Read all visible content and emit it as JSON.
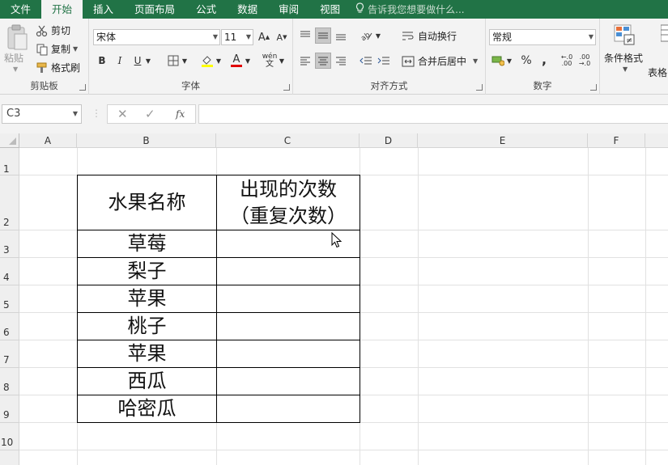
{
  "menu": {
    "tabs": [
      "文件",
      "开始",
      "插入",
      "页面布局",
      "公式",
      "数据",
      "审阅",
      "视图"
    ],
    "active_index": 1,
    "tell_me": "告诉我您想要做什么..."
  },
  "ribbon": {
    "clipboard": {
      "label": "剪贴板",
      "paste": "粘贴",
      "cut": "剪切",
      "copy": "复制",
      "format_painter": "格式刷"
    },
    "font": {
      "label": "字体",
      "font_name": "宋体",
      "font_size": "11",
      "bold": "B",
      "italic": "I",
      "underline": "U",
      "phonetic": "wén"
    },
    "alignment": {
      "label": "对齐方式",
      "wrap_text": "自动换行",
      "merge_center": "合并后居中"
    },
    "number": {
      "label": "数字",
      "format": "常规",
      "percent": "%",
      "comma": ","
    },
    "styles": {
      "conditional_format": "条件格式",
      "table_format": "表格"
    }
  },
  "formula_bar": {
    "name_box": "C3",
    "fx": "fx"
  },
  "sheet": {
    "columns": [
      "A",
      "B",
      "C",
      "D",
      "E",
      "F"
    ],
    "rows": [
      "1",
      "2",
      "3",
      "4",
      "5",
      "6",
      "7",
      "8",
      "9",
      "10"
    ],
    "header_b2": "水果名称",
    "header_c2_line1": "出现的次数",
    "header_c2_line2": "（重复次数）",
    "fruits": [
      "草莓",
      "梨子",
      "苹果",
      "桃子",
      "苹果",
      "西瓜",
      "哈密瓜"
    ]
  },
  "colors": {
    "excel_green": "#217346",
    "ribbon_bg": "#f3f3f3",
    "header_bg": "#efefef",
    "gridline": "#e1e1e1"
  }
}
